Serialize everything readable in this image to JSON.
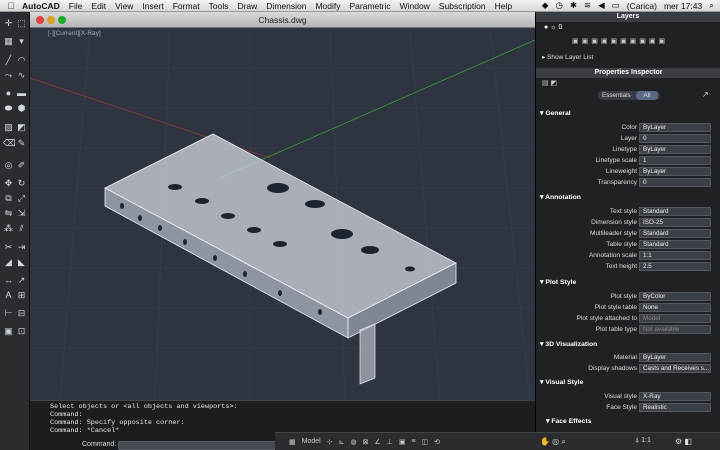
{
  "menubar": {
    "apple": "",
    "app": "AutoCAD",
    "items": [
      "File",
      "Edit",
      "View",
      "Insert",
      "Format",
      "Tools",
      "Draw",
      "Dimension",
      "Modify",
      "Parametric",
      "Window",
      "Subscription",
      "Help"
    ],
    "battery": "(Carica)",
    "clock": "mer 17:43"
  },
  "document": {
    "title": "Chassis.dwg",
    "viewport_label": "[-][Current][X-Ray]"
  },
  "command": {
    "lines": [
      "Select objects or <all objects and viewports>:",
      "Command:",
      "Command: Specify opposite corner:",
      "Command: *Cancel*"
    ],
    "label": "Command:"
  },
  "status": {
    "model": "Model",
    "scale": "1:1"
  },
  "layers": {
    "title": "Layers",
    "current": "0",
    "show_list": "Show Layer List"
  },
  "inspector": {
    "title": "Properties Inspector",
    "tab_essentials": "Essentials",
    "tab_all": "All",
    "general": {
      "title": "General",
      "color_label": "Color",
      "color": "ByLayer",
      "layer_label": "Layer",
      "layer": "0",
      "linetype_label": "Linetype",
      "linetype": "ByLayer",
      "ltscale_label": "Linetype scale",
      "ltscale": "1",
      "lineweight_label": "Lineweight",
      "lineweight": "ByLayer",
      "transparency_label": "Transparency",
      "transparency": "0"
    },
    "annotation": {
      "title": "Annotation",
      "text_style_label": "Text style",
      "text_style": "Standard",
      "dim_style_label": "Dimension style",
      "dim_style": "ISO-25",
      "mleader_label": "Multileader style",
      "mleader": "Standard",
      "table_style_label": "Table style",
      "table_style": "Standard",
      "anno_scale_label": "Annotation scale",
      "anno_scale": "1:1",
      "text_height_label": "Text height",
      "text_height": "2.5"
    },
    "plot": {
      "title": "Plot Style",
      "plot_style_label": "Plot style",
      "plot_style": "ByColor",
      "plot_table_label": "Plot style table",
      "plot_table": "None",
      "attached_label": "Plot style attached to",
      "attached": "Model",
      "table_type_label": "Plot table type",
      "table_type": "Not available"
    },
    "viz3d": {
      "title": "3D Visualization",
      "material_label": "Material",
      "material": "ByLayer",
      "shadows_label": "Display shadows",
      "shadows": "Casts and Receives s..."
    },
    "visual": {
      "title": "Visual Style",
      "vstyle_label": "Visual style",
      "vstyle": "X-Ray",
      "face_label": "Face Style",
      "face": "Realistic"
    },
    "face_effects": "Face Effects"
  }
}
